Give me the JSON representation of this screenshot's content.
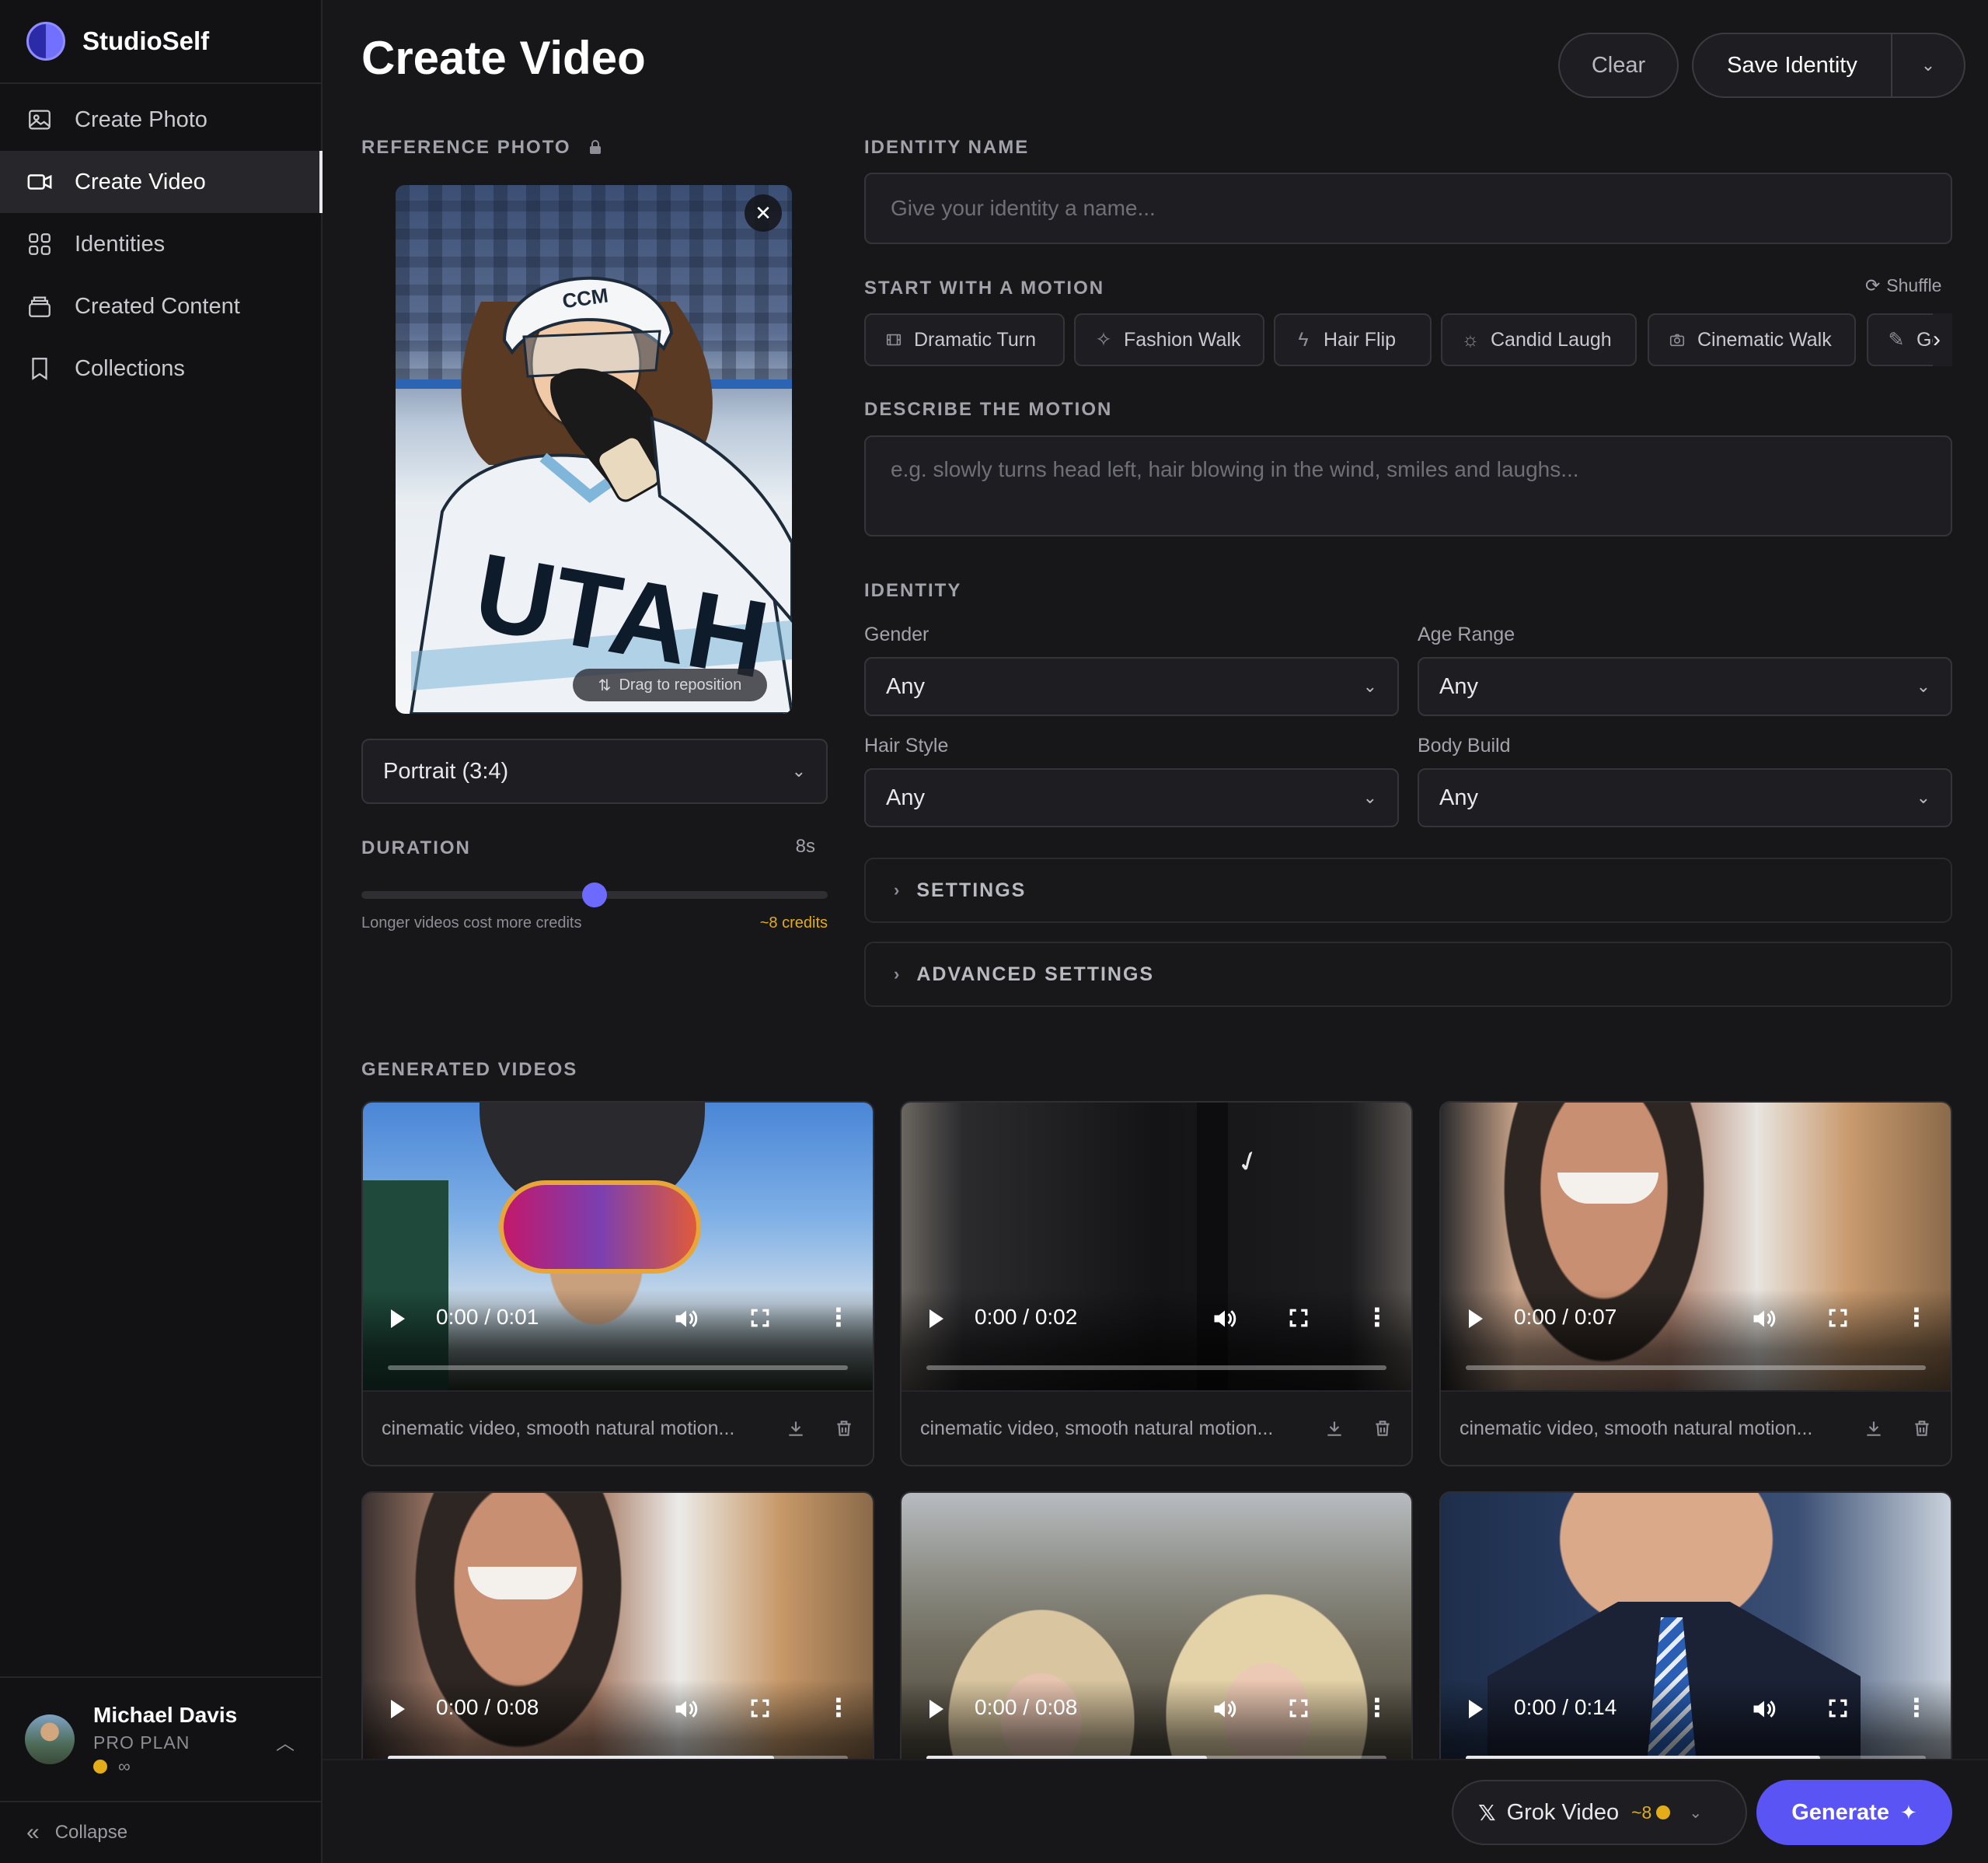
{
  "app": {
    "name": "StudioSelf"
  },
  "sidebar": {
    "items": [
      {
        "label": "Create Photo",
        "icon": "image-icon",
        "active": false
      },
      {
        "label": "Create Video",
        "icon": "video-icon",
        "active": true
      },
      {
        "label": "Identities",
        "icon": "grid-icon",
        "active": false
      },
      {
        "label": "Created Content",
        "icon": "stack-icon",
        "active": false
      },
      {
        "label": "Collections",
        "icon": "bookmark-icon",
        "active": false
      }
    ],
    "user": {
      "name": "Michael Davis",
      "plan": "PRO PLAN",
      "credits": "∞"
    },
    "collapse_label": "Collapse"
  },
  "header": {
    "title": "Create Video",
    "clear_label": "Clear",
    "save_label": "Save Identity"
  },
  "reference": {
    "label": "REFERENCE PHOTO",
    "drag_hint": "Drag to reposition",
    "aspect": "Portrait (3:4)",
    "jersey_text": "UTAH",
    "helmet_text": "CCM"
  },
  "duration": {
    "label": "DURATION",
    "value": "8s",
    "note": "Longer videos cost more credits",
    "credits": "~8 credits",
    "level_fraction": 0.5
  },
  "identity_name": {
    "label": "IDENTITY NAME",
    "placeholder": "Give your identity a name..."
  },
  "motion": {
    "label": "START WITH A MOTION",
    "shuffle_label": "Shuffle",
    "chips": [
      {
        "label": "Dramatic Turn",
        "icon": "film-icon"
      },
      {
        "label": "Fashion Walk",
        "icon": "sparkle-icon"
      },
      {
        "label": "Hair Flip",
        "icon": "bolt-icon"
      },
      {
        "label": "Candid Laugh",
        "icon": "sun-icon"
      },
      {
        "label": "Cinematic Walk",
        "icon": "camera-icon"
      },
      {
        "label": "Ge",
        "icon": "brush-icon"
      }
    ],
    "describe_label": "DESCRIBE THE MOTION",
    "describe_placeholder": "e.g. slowly turns head left, hair blowing in the wind, smiles and laughs..."
  },
  "identity": {
    "label": "IDENTITY",
    "gender_label": "Gender",
    "gender_value": "Any",
    "age_label": "Age Range",
    "age_value": "Any",
    "hair_label": "Hair Style",
    "hair_value": "Any",
    "body_label": "Body Build",
    "body_value": "Any"
  },
  "settings_label": "SETTINGS",
  "advanced_label": "ADVANCED SETTINGS",
  "generated": {
    "label": "GENERATED VIDEOS",
    "videos": [
      {
        "time": "0:00 / 0:01",
        "caption": "cinematic video, smooth natural motion...",
        "scene": "skier-goggles"
      },
      {
        "time": "0:00 / 0:02",
        "caption": "cinematic video, smooth natural motion...",
        "scene": "black-jacket"
      },
      {
        "time": "0:00 / 0:07",
        "caption": "cinematic video, smooth natural motion...",
        "scene": "smiling-selfie"
      },
      {
        "time": "0:00 / 0:08",
        "caption": "",
        "scene": "smiling-selfie-2",
        "progress": 0.84
      },
      {
        "time": "0:00 / 0:08",
        "caption": "",
        "scene": "film-set",
        "progress": 0.61
      },
      {
        "time": "0:00 / 0:14",
        "caption": "",
        "scene": "suit-tie",
        "progress": 0.77
      }
    ]
  },
  "footer": {
    "model_label": "Grok Video",
    "model_cost": "~8",
    "generate_label": "Generate"
  },
  "colors": {
    "accent": "#5b54f5",
    "gold": "#e2ad18",
    "background": "#17171a",
    "sidebar": "#121214"
  }
}
